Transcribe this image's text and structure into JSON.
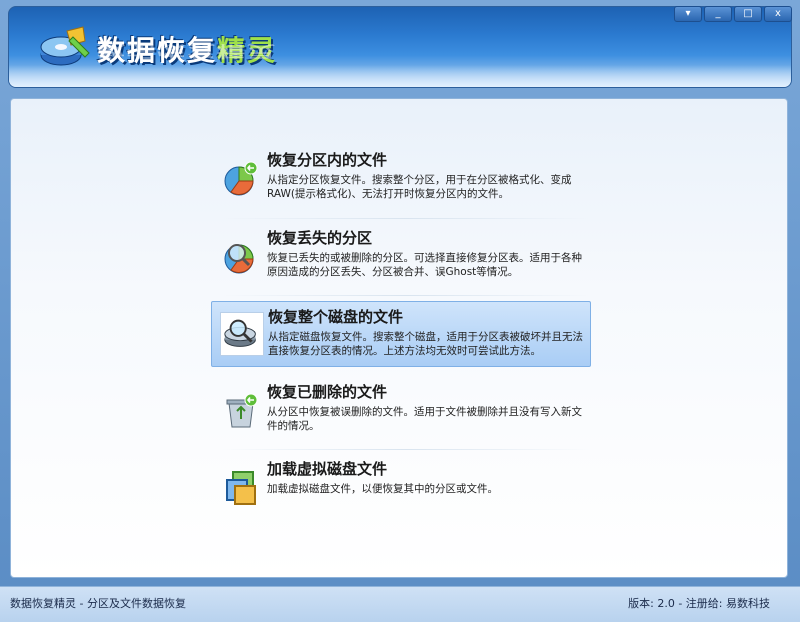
{
  "app": {
    "title_main": "数据恢复",
    "title_accent": "精灵",
    "logo_icon": "disk-recovery-logo-icon"
  },
  "window_controls": {
    "menu": "▾",
    "minimize": "_",
    "maximize": "□",
    "close": "x"
  },
  "options": [
    {
      "title": "恢复分区内的文件",
      "desc": "从指定分区恢复文件。搜索整个分区，用于在分区被格式化、变成RAW(提示格式化)、无法打开时恢复分区内的文件。",
      "icon": "partition-pie-icon"
    },
    {
      "title": "恢复丢失的分区",
      "desc": "恢复已丢失的或被删除的分区。可选择直接修复分区表。适用于各种原因造成的分区丢失、分区被合并、误Ghost等情况。",
      "icon": "partition-search-icon"
    },
    {
      "title": "恢复整个磁盘的文件",
      "desc": "从指定磁盘恢复文件。搜索整个磁盘，适用于分区表被破坏并且无法直接恢复分区表的情况。上述方法均无效时可尝试此方法。",
      "icon": "disk-search-icon"
    },
    {
      "title": "恢复已删除的文件",
      "desc": "从分区中恢复被误删除的文件。适用于文件被删除并且没有写入新文件的情况。",
      "icon": "recycle-bin-icon"
    },
    {
      "title": "加载虚拟磁盘文件",
      "desc": "加载虚拟磁盘文件，以便恢复其中的分区或文件。",
      "icon": "virtual-disk-icon"
    }
  ],
  "status": {
    "left": "数据恢复精灵 - 分区及文件数据恢复",
    "right": "版本: 2.0 - 注册给: 易数科技"
  },
  "colors": {
    "banner_blue": "#2b7ad0",
    "accent_green": "#9fe04a",
    "selected_bg": "#b8d6f7"
  }
}
